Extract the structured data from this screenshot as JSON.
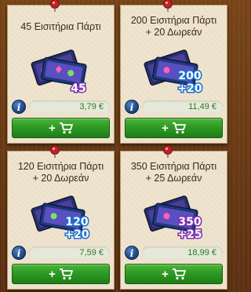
{
  "offers": [
    {
      "title_lines": [
        "45 Εισιτήρια Πάρτι"
      ],
      "badge_top": "45",
      "badge_bottom": "",
      "price": "3,79 €",
      "info_label": "i"
    },
    {
      "title_lines": [
        "200 Εισιτήρια Πάρτι",
        "+ 20 Δωρεάν"
      ],
      "badge_top": "200",
      "badge_bottom": "+20",
      "price": "11,49 €",
      "info_label": "i"
    },
    {
      "title_lines": [
        "120 Εισιτήρια Πάρτι",
        "+ 20 Δωρεάν"
      ],
      "badge_top": "120",
      "badge_bottom": "+20",
      "price": "7,59 €",
      "info_label": "i"
    },
    {
      "title_lines": [
        "350 Εισιτήρια Πάρτι",
        "+ 25 Δωρεάν"
      ],
      "badge_top": "350",
      "badge_bottom": "+25",
      "price": "18,99 €",
      "info_label": "i"
    }
  ],
  "buy_button": {
    "plus": "+",
    "icon": "shopping-cart-icon"
  },
  "colors": {
    "background_wood": "#6e3d16",
    "card": "#efe4cf",
    "buy_green": "#2e9a24",
    "price_green": "#2b7a1a",
    "info_blue": "#1f4a8a",
    "pin_red": "#c0202a",
    "badge_purple": "#7a2fb0"
  }
}
